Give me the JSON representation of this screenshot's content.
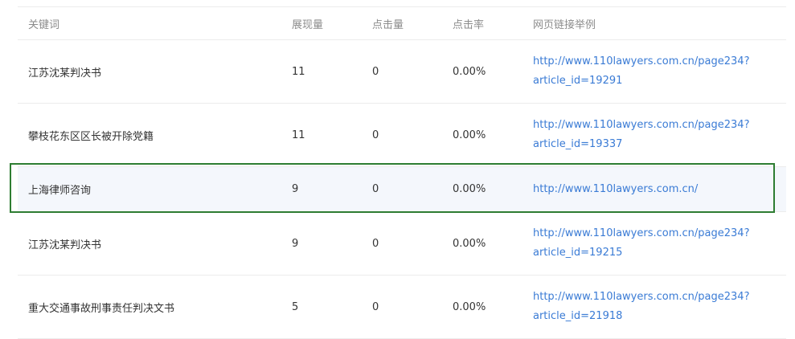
{
  "headers": {
    "keyword": "关键词",
    "impressions": "展现量",
    "clicks": "点击量",
    "ctr": "点击率",
    "url_example": "网页链接举例"
  },
  "rows": [
    {
      "keyword": "江苏沈某判决书",
      "impressions": "11",
      "clicks": "0",
      "ctr": "0.00%",
      "url_line1": "http://www.110lawyers.com.cn/page234?",
      "url_line2": "article_id=19291"
    },
    {
      "keyword": "攀枝花东区区长被开除党籍",
      "impressions": "11",
      "clicks": "0",
      "ctr": "0.00%",
      "url_line1": "http://www.110lawyers.com.cn/page234?",
      "url_line2": "article_id=19337"
    },
    {
      "keyword": "上海律师咨询",
      "impressions": "9",
      "clicks": "0",
      "ctr": "0.00%",
      "url_line1": "http://www.110lawyers.com.cn/",
      "url_line2": ""
    },
    {
      "keyword": "江苏沈某判决书",
      "impressions": "9",
      "clicks": "0",
      "ctr": "0.00%",
      "url_line1": "http://www.110lawyers.com.cn/page234?",
      "url_line2": "article_id=19215"
    },
    {
      "keyword": "重大交通事故刑事责任判决文书",
      "impressions": "5",
      "clicks": "0",
      "ctr": "0.00%",
      "url_line1": "http://www.110lawyers.com.cn/page234?",
      "url_line2": "article_id=21918"
    }
  ]
}
